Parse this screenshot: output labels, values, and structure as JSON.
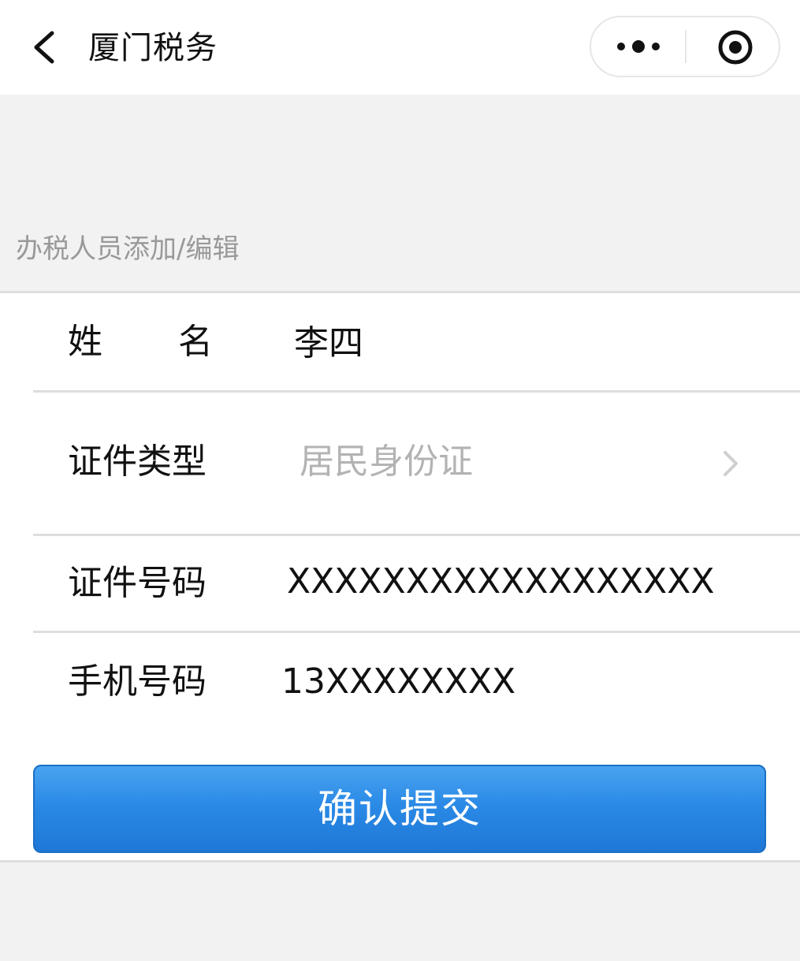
{
  "nav": {
    "title": "厦门税务"
  },
  "icons": {
    "back": "chevron-left-icon",
    "more": "more-dots-icon",
    "close": "target-close-icon",
    "row_arrow": "chevron-right-icon"
  },
  "section": {
    "header": "办税人员添加/编辑"
  },
  "form": {
    "name": {
      "label": "姓名",
      "value": "李四"
    },
    "id_type": {
      "label": "证件类型",
      "placeholder": "居民身份证"
    },
    "id_number": {
      "label": "证件号码",
      "value": "XXXXXXXXXXXXXXXXXX"
    },
    "phone": {
      "label": "手机号码",
      "value": "13XXXXXXXX"
    }
  },
  "submit": {
    "label": "确认提交"
  },
  "colors": {
    "background": "#f2f2f2",
    "card": "#ffffff",
    "divider": "#dedede",
    "placeholder": "#b3b3b3",
    "section_header": "#999999",
    "button_top": "#4aa3f0",
    "button_bottom": "#1f77d6"
  }
}
